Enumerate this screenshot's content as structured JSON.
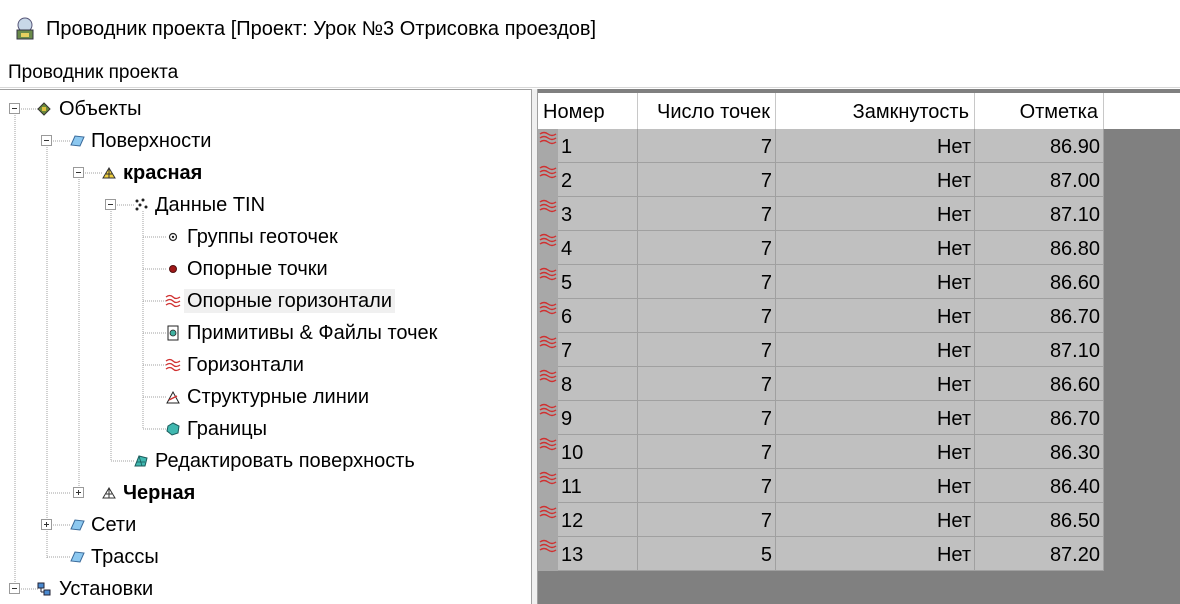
{
  "window": {
    "title": "Проводник проекта [Проект: Урок №3 Отрисовка проездов]"
  },
  "menu": {
    "items": [
      "Проводник проекта"
    ]
  },
  "tree": {
    "nodes": [
      {
        "label": "Объекты",
        "icon": "objects-icon",
        "expander": "minus",
        "bold": false
      },
      {
        "label": "Поверхности",
        "icon": "surfaces-folder-icon",
        "expander": "minus",
        "bold": false
      },
      {
        "label": "красная",
        "icon": "surface-icon",
        "expander": "minus",
        "bold": true
      },
      {
        "label": "Данные TIN",
        "icon": "tin-data-icon",
        "expander": "minus",
        "bold": false
      },
      {
        "label": "Группы геоточек",
        "icon": "point-group-icon",
        "expander": "none",
        "bold": false
      },
      {
        "label": "Опорные точки",
        "icon": "reference-point-icon",
        "expander": "none",
        "bold": false
      },
      {
        "label": "Опорные горизонтали",
        "icon": "contour-icon",
        "expander": "none",
        "bold": false,
        "selected": true
      },
      {
        "label": "Примитивы & Файлы точек",
        "icon": "point-file-icon",
        "expander": "none",
        "bold": false
      },
      {
        "label": "Горизонтали",
        "icon": "contour-icon",
        "expander": "none",
        "bold": false
      },
      {
        "label": "Структурные линии",
        "icon": "breakline-icon",
        "expander": "none",
        "bold": false
      },
      {
        "label": "Границы",
        "icon": "boundary-icon",
        "expander": "none",
        "bold": false
      },
      {
        "label": "Редактировать поверхность",
        "icon": "edit-surface-icon",
        "expander": "none",
        "bold": false
      },
      {
        "label": "Черная",
        "icon": "surface-icon",
        "expander": "plus",
        "bold": true
      },
      {
        "label": "Сети",
        "icon": "folder-icon",
        "expander": "plus",
        "bold": false
      },
      {
        "label": "Трассы",
        "icon": "folder-icon",
        "expander": "none",
        "bold": false
      },
      {
        "label": "Установки",
        "icon": "settings-icon",
        "expander": "minus",
        "bold": false
      }
    ]
  },
  "grid": {
    "columns": [
      "Номер",
      "Число точек",
      "Замкнутость",
      "Отметка"
    ],
    "rows": [
      [
        "1",
        "7",
        "Нет",
        "86.90"
      ],
      [
        "2",
        "7",
        "Нет",
        "87.00"
      ],
      [
        "3",
        "7",
        "Нет",
        "87.10"
      ],
      [
        "4",
        "7",
        "Нет",
        "86.80"
      ],
      [
        "5",
        "7",
        "Нет",
        "86.60"
      ],
      [
        "6",
        "7",
        "Нет",
        "86.70"
      ],
      [
        "7",
        "7",
        "Нет",
        "87.10"
      ],
      [
        "8",
        "7",
        "Нет",
        "86.60"
      ],
      [
        "9",
        "7",
        "Нет",
        "86.70"
      ],
      [
        "10",
        "7",
        "Нет",
        "86.30"
      ],
      [
        "11",
        "7",
        "Нет",
        "86.40"
      ],
      [
        "12",
        "7",
        "Нет",
        "86.50"
      ],
      [
        "13",
        "5",
        "Нет",
        "87.20"
      ]
    ],
    "row_marker_icon": "contour-icon"
  },
  "colors": {
    "contour": "#d03030",
    "cell_bg": "#c0c0c0",
    "grid_bg": "#808080",
    "selection": "#f0f0f0"
  }
}
